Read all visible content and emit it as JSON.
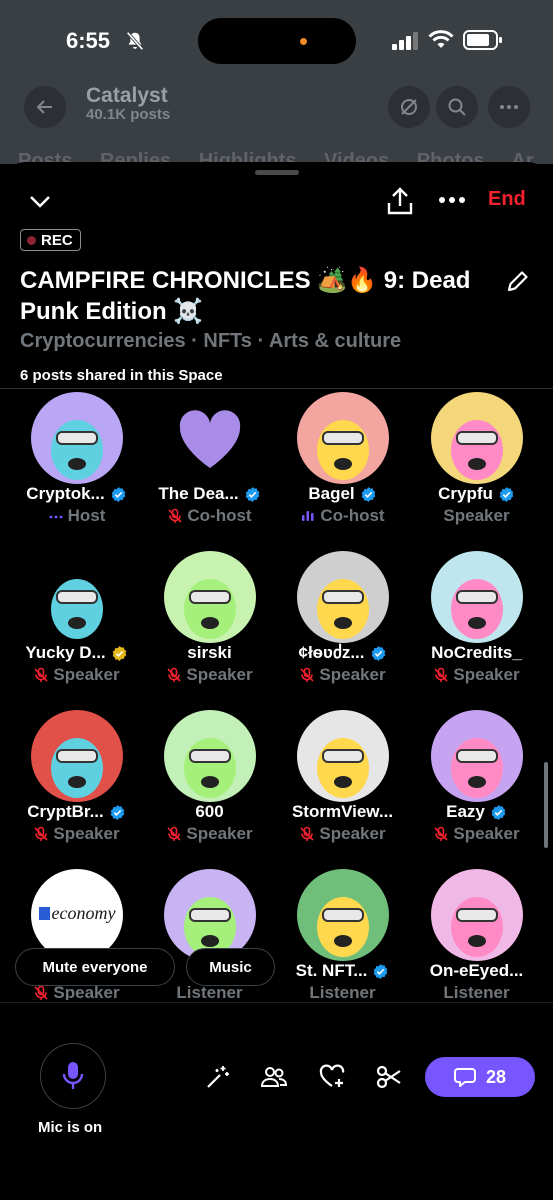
{
  "status_bar": {
    "time": "6:55"
  },
  "background_profile": {
    "name": "Catalyst",
    "posts": "40.1K posts",
    "tabs": "Posts Replies Highlights Videos Photos Ar"
  },
  "space": {
    "end_label": "End",
    "rec_label": "REC",
    "title": "CAMPFIRE CHRONICLES 🏕️🔥 9: Dead Punk Edition ☠️",
    "topics": "Cryptocurrencies · NFTs · Arts & culture",
    "posts_shared": "6 posts shared in this Space"
  },
  "participants": [
    {
      "name": "Cryptok...",
      "role": "Host",
      "verified": "blue",
      "role_icon": "dots-icon",
      "bg": "#b9a7f5"
    },
    {
      "name": "The Dea...",
      "role": "Co-host",
      "verified": "blue",
      "role_icon": "mic-off-icon",
      "bg": "#000000"
    },
    {
      "name": "Bagel",
      "role": "Co-host",
      "verified": "blue",
      "role_icon": "speaking-bars-icon",
      "bg": "#f3a6a0"
    },
    {
      "name": "Crypfu",
      "role": "Speaker",
      "verified": "blue",
      "role_icon": "",
      "bg": "#f3d77a"
    },
    {
      "name": "Yucky D...",
      "role": "Speaker",
      "verified": "gold",
      "role_icon": "mic-off-icon",
      "bg": "#000000"
    },
    {
      "name": "sirski",
      "role": "Speaker",
      "verified": "",
      "role_icon": "mic-off-icon",
      "bg": "#c8f2b0"
    },
    {
      "name": "¢łѳʋძz...",
      "role": "Speaker",
      "verified": "blue",
      "role_icon": "mic-off-icon",
      "bg": "#cfcfcf"
    },
    {
      "name": "NoCredits_",
      "role": "Speaker",
      "verified": "",
      "role_icon": "mic-off-icon",
      "bg": "#bfe6ee"
    },
    {
      "name": "CryptBr...",
      "role": "Speaker",
      "verified": "blue",
      "role_icon": "mic-off-icon",
      "bg": "#e2504a"
    },
    {
      "name": "600",
      "role": "Speaker",
      "verified": "",
      "role_icon": "mic-off-icon",
      "bg": "#c2f0b8"
    },
    {
      "name": "StormView...",
      "role": "Speaker",
      "verified": "",
      "role_icon": "mic-off-icon",
      "bg": "#e6e6e6"
    },
    {
      "name": "Eazy",
      "role": "Speaker",
      "verified": "blue",
      "role_icon": "mic-off-icon",
      "bg": "#c7a4f2"
    },
    {
      "name": "",
      "role": "Speaker",
      "verified": "",
      "role_icon": "mic-off-icon",
      "bg": "#ffffff",
      "logo_text": "economy"
    },
    {
      "name": "",
      "role": "Listener",
      "verified": "",
      "role_icon": "",
      "bg": "#c9b4f3"
    },
    {
      "name": "St. NFT...",
      "role": "Listener",
      "verified": "blue",
      "role_icon": "",
      "bg": "#6fbf7a"
    },
    {
      "name": "On-eEyed...",
      "role": "Listener",
      "verified": "",
      "role_icon": "",
      "bg": "#f0b8e6"
    }
  ],
  "pills": {
    "mute_everyone": "Mute everyone",
    "music": "Music"
  },
  "bottom": {
    "mic_label": "Mic is on",
    "chat_count": "28"
  },
  "colors": {
    "accent": "#7856ff",
    "verified": "#1d9bf0",
    "gold": "#e2b719",
    "end": "#f4212e",
    "muted_icon": "#f4212e"
  }
}
